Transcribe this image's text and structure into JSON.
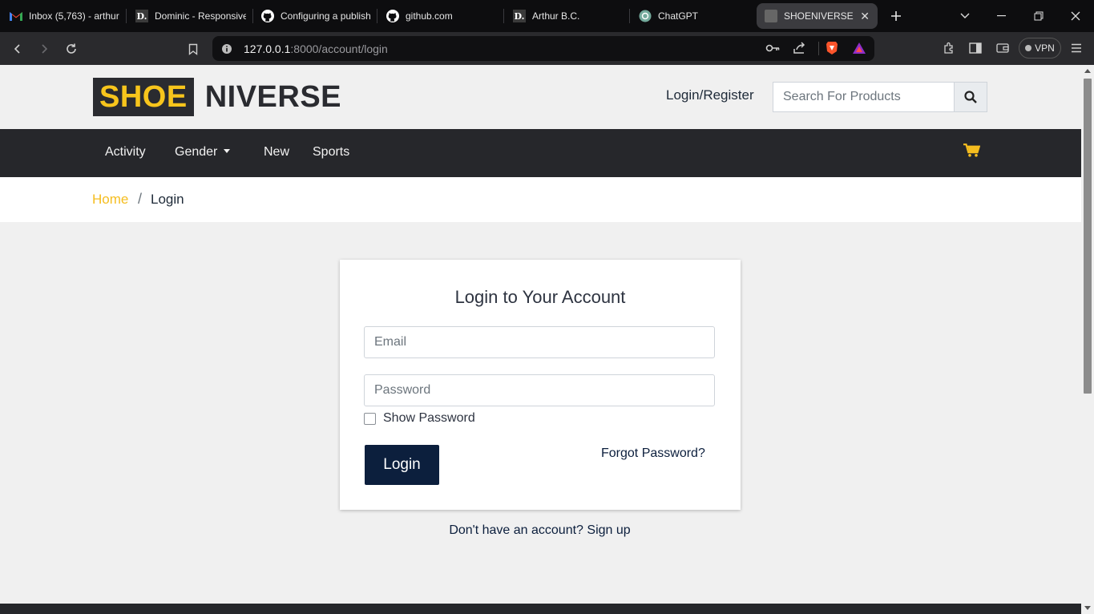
{
  "browser": {
    "tabs": [
      {
        "title": "Inbox (5,763) - arthur",
        "icon": "gmail-icon"
      },
      {
        "title": "Dominic - Responsive",
        "icon": "d-icon"
      },
      {
        "title": "Configuring a publish",
        "icon": "github-icon"
      },
      {
        "title": "github.com",
        "icon": "github-icon"
      },
      {
        "title": "Arthur B.C.",
        "icon": "d-icon"
      },
      {
        "title": "ChatGPT",
        "icon": "chatgpt-icon"
      },
      {
        "title": "SHOENIVERSE",
        "icon": "page-icon",
        "active": true
      }
    ],
    "url_host": "127.0.0.1",
    "url_path": ":8000/account/login",
    "vpn_label": "VPN"
  },
  "header": {
    "logo_part1": "SHOE",
    "logo_part2": "NIVERSE",
    "login_register": "Login/Register",
    "search_placeholder": "Search For Products"
  },
  "nav": {
    "items": [
      "Activity",
      "Gender",
      "New",
      "Sports"
    ]
  },
  "breadcrumb": {
    "home": "Home",
    "separator": "/",
    "current": "Login"
  },
  "login": {
    "title": "Login to Your Account",
    "email_placeholder": "Email",
    "password_placeholder": "Password",
    "show_password": "Show Password",
    "login_button": "Login",
    "forgot_password": "Forgot Password?",
    "signup_text": "Don't have an account? Sign up"
  },
  "colors": {
    "brand_yellow": "#f7c51c",
    "dark": "#26272b",
    "navy": "#0c1f3d"
  }
}
